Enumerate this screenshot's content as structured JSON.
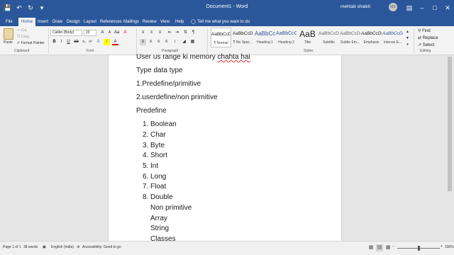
{
  "title_bar": {
    "document_title": "Document1 - Word",
    "user_name": "mehtab shaikh",
    "avatar_initials": "MS"
  },
  "tabs": [
    "File",
    "Home",
    "Insert",
    "Draw",
    "Design",
    "Layout",
    "References",
    "Mailings",
    "Review",
    "View",
    "Help"
  ],
  "tell_me": "Tell me what you want to do",
  "clipboard": {
    "paste": "Paste",
    "cut": "Cut",
    "copy": "Copy",
    "format_painter": "Format Painter",
    "label": "Clipboard"
  },
  "font": {
    "name": "Calibri (Body)",
    "size": "20",
    "label": "Font"
  },
  "paragraph": {
    "label": "Paragraph"
  },
  "styles": {
    "label": "Styles",
    "items": [
      {
        "preview": "AaBbCcDd",
        "name": "¶ Normal"
      },
      {
        "preview": "AaBbCcDd",
        "name": "¶ No Spac..."
      },
      {
        "preview": "AaBbCc",
        "name": "Heading 1"
      },
      {
        "preview": "AaBbCcC",
        "name": "Heading 2"
      },
      {
        "preview": "AaB",
        "name": "Title"
      },
      {
        "preview": "AaBbCcD",
        "name": "Subtitle"
      },
      {
        "preview": "AaBbCcDd",
        "name": "Subtle Em..."
      },
      {
        "preview": "AaBbCcDd",
        "name": "Emphasis"
      },
      {
        "preview": "AaBbCcDd",
        "name": "Intense E..."
      }
    ]
  },
  "editing": {
    "label": "Editing",
    "find": "Find",
    "replace": "Replace",
    "select": "Select"
  },
  "document": {
    "line1_prefix": "User us range ki memory ",
    "line1_underlined": "chahta hai",
    "line2": "Type data type",
    "line3": "1.Predefine/primitive",
    "line4": "2.userdefine/non primitive",
    "line5": "Predefine",
    "list": [
      {
        "num": "1.",
        "text": "Boolean"
      },
      {
        "num": "2.",
        "text": "Char"
      },
      {
        "num": "3.",
        "text": "Byte"
      },
      {
        "num": "4.",
        "text": "Short"
      },
      {
        "num": "5.",
        "text": "Int"
      },
      {
        "num": "6.",
        "text": "Long"
      },
      {
        "num": "7.",
        "text": "Float"
      },
      {
        "num": "8.",
        "text": "Double"
      }
    ],
    "sub_lines": [
      "Non primitive",
      "Array",
      "String",
      "Classes"
    ]
  },
  "status": {
    "page": "Page 1 of 1",
    "words": "38 words",
    "language": "English (India)",
    "accessibility": "Accessibility: Good to go",
    "zoom": "100%"
  },
  "colors": {
    "brand": "#2b579a",
    "ribbon": "#f3f3f3",
    "workspace": "#e6e6e6"
  }
}
